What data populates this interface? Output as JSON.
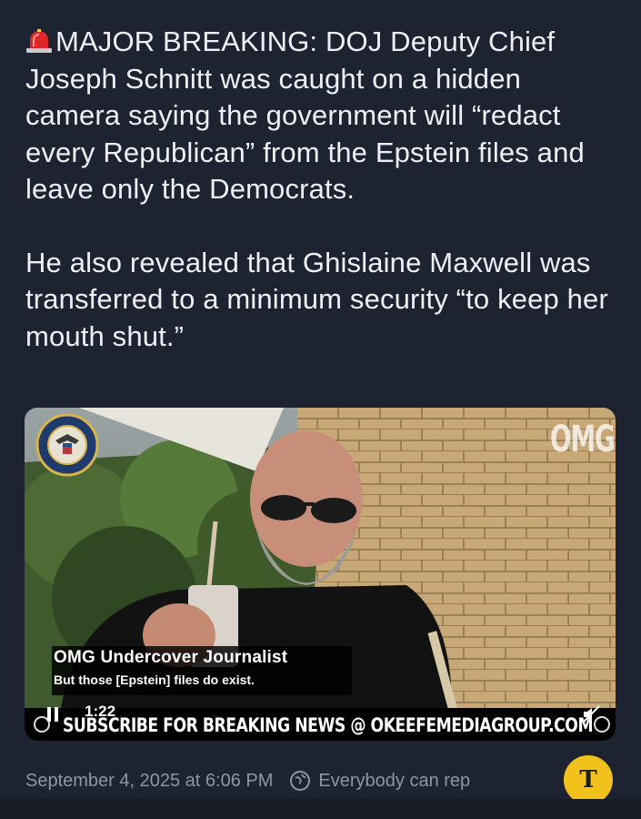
{
  "post": {
    "headline_icon": "police-siren-icon",
    "paragraph1": "MAJOR BREAKING: DOJ Deputy Chief Joseph Schnitt was caught on a hidden camera saying the government will “redact every Republican” from the Epstein files and leave only the Democrats.",
    "paragraph2": "He also revealed that Ghislaine Maxwell was transferred to a minimum security “to keep her mouth shut.”"
  },
  "video": {
    "caption_title": "OMG Undercover Journalist",
    "caption_quote": "But those [Epstein] files do exist.",
    "ticker": "SUBSCRIBE FOR BREAKING NEWS @ OKEEFEMEDIAGROUP.COM",
    "timestamp": "1:22",
    "watermark": "OMG",
    "seal_icon": "doj-seal-icon"
  },
  "meta": {
    "date": "September 4, 2025 at 6:06 PM",
    "reply_setting": "Everybody can rep"
  },
  "badge": {
    "letter": "T"
  },
  "colors": {
    "background": "#1d2330",
    "text": "#eef0f5",
    "meta_text": "#8f96a3",
    "badge": "#f1c21b"
  }
}
